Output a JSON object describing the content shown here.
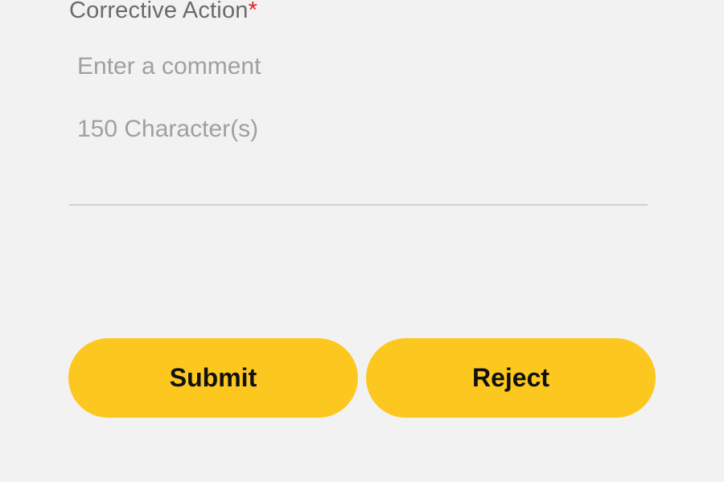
{
  "form": {
    "corrective_action_label": "Corrective Action",
    "required_marker": "*",
    "comment_placeholder": "Enter a comment",
    "char_limit_text": "150 Character(s)"
  },
  "actions": {
    "submit_label": "Submit",
    "reject_label": "Reject"
  },
  "colors": {
    "background": "#f2f2f2",
    "button": "#fcc81f",
    "required": "#e0201f",
    "label": "#6b6b6b",
    "hint": "#a0a0a0"
  }
}
